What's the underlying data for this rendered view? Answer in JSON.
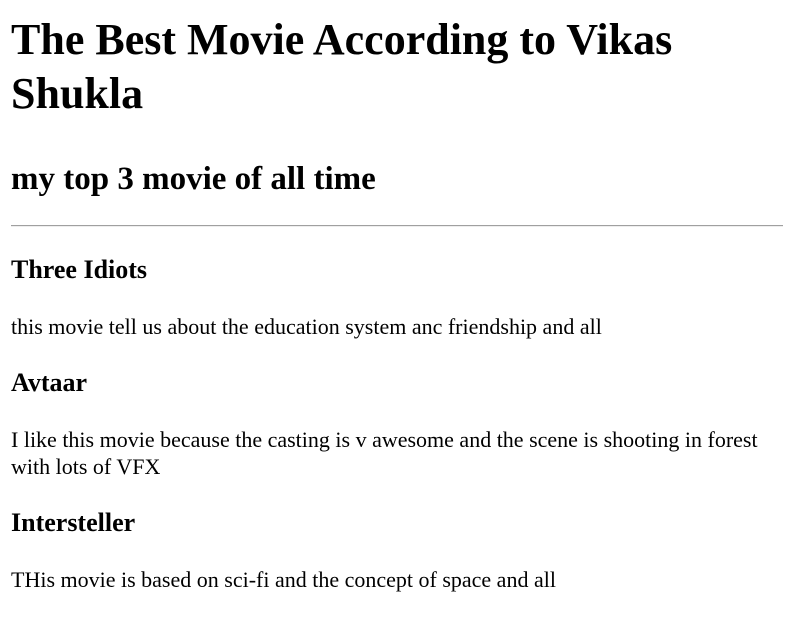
{
  "page": {
    "title": "The Best Movie According to Vikas Shukla",
    "subtitle": "my top 3 movie of all time"
  },
  "movies": [
    {
      "title": "Three Idiots",
      "description": "this movie tell us about the education system anc friendship and all"
    },
    {
      "title": "Avtaar",
      "description": "I like this movie because the casting is v awesome and the scene is shooting in forest with lots of VFX"
    },
    {
      "title": "Intersteller",
      "description": "THis movie is based on sci-fi and the concept of space and all"
    }
  ]
}
